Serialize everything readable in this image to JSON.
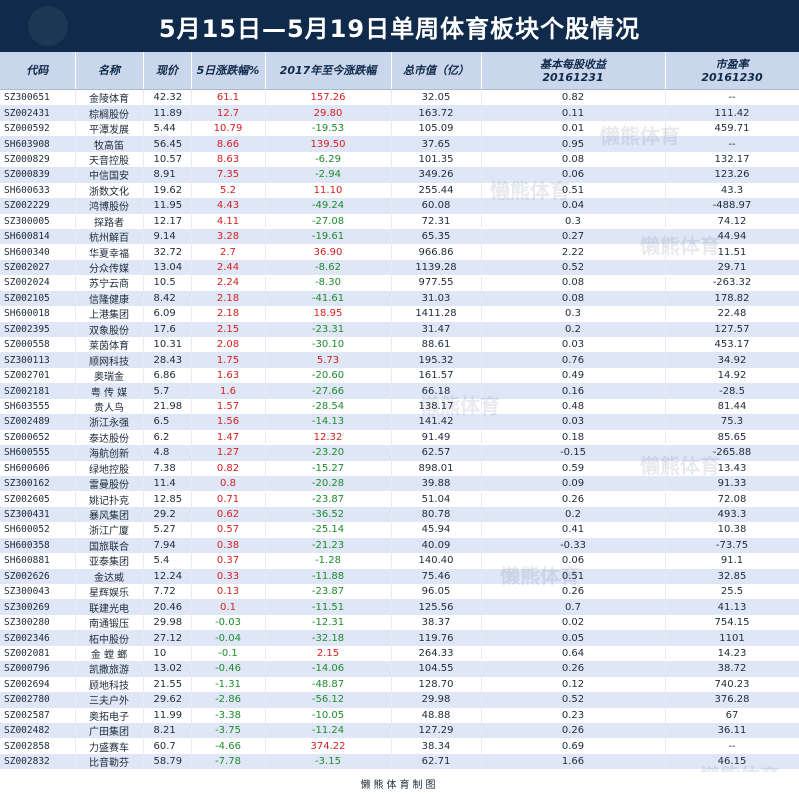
{
  "title": "5月15日—5月19日单周体育板块个股情况",
  "headers": {
    "code": "代码",
    "name": "名称",
    "price": "现价",
    "week_change": "5日涨跌幅%",
    "ytd_change": "2017年至今涨跌幅",
    "market_cap": "总市值（亿）",
    "eps_line1": "基本每股收益",
    "eps_line2": "20161231",
    "pe_line1": "市盈率",
    "pe_line2": "20161230"
  },
  "rows": [
    {
      "code": "SZ300651",
      "name": "金陵体育",
      "price": "42.32",
      "week": "61.1",
      "week_dir": "up",
      "ytd": "157.26",
      "ytd_dir": "up",
      "cap": "32.05",
      "eps": "0.82",
      "pe": "--"
    },
    {
      "code": "SZ002431",
      "name": "棕榈股份",
      "price": "11.89",
      "week": "12.7",
      "week_dir": "up",
      "ytd": "29.80",
      "ytd_dir": "up",
      "cap": "163.72",
      "eps": "0.11",
      "pe": "111.42"
    },
    {
      "code": "SZ000592",
      "name": "平潭发展",
      "price": "5.44",
      "week": "10.79",
      "week_dir": "up",
      "ytd": "-19.53",
      "ytd_dir": "down",
      "cap": "105.09",
      "eps": "0.01",
      "pe": "459.71"
    },
    {
      "code": "SH603908",
      "name": "牧高笛",
      "price": "56.45",
      "week": "8.66",
      "week_dir": "up",
      "ytd": "139.50",
      "ytd_dir": "up",
      "cap": "37.65",
      "eps": "0.95",
      "pe": "--"
    },
    {
      "code": "SZ000829",
      "name": "天音控股",
      "price": "10.57",
      "week": "8.63",
      "week_dir": "up",
      "ytd": "-6.29",
      "ytd_dir": "down",
      "cap": "101.35",
      "eps": "0.08",
      "pe": "132.17"
    },
    {
      "code": "SZ000839",
      "name": "中信国安",
      "price": "8.91",
      "week": "7.35",
      "week_dir": "up",
      "ytd": "-2.94",
      "ytd_dir": "down",
      "cap": "349.26",
      "eps": "0.06",
      "pe": "123.26"
    },
    {
      "code": "SH600633",
      "name": "浙数文化",
      "price": "19.62",
      "week": "5.2",
      "week_dir": "up",
      "ytd": "11.10",
      "ytd_dir": "up",
      "cap": "255.44",
      "eps": "0.51",
      "pe": "43.3"
    },
    {
      "code": "SZ002229",
      "name": "鸿博股份",
      "price": "11.95",
      "week": "4.43",
      "week_dir": "up",
      "ytd": "-49.24",
      "ytd_dir": "down",
      "cap": "60.08",
      "eps": "0.04",
      "pe": "-488.97"
    },
    {
      "code": "SZ300005",
      "name": "探路者",
      "price": "12.17",
      "week": "4.11",
      "week_dir": "up",
      "ytd": "-27.08",
      "ytd_dir": "down",
      "cap": "72.31",
      "eps": "0.3",
      "pe": "74.12"
    },
    {
      "code": "SH600814",
      "name": "杭州解百",
      "price": "9.14",
      "week": "3.28",
      "week_dir": "up",
      "ytd": "-19.61",
      "ytd_dir": "down",
      "cap": "65.35",
      "eps": "0.27",
      "pe": "44.94"
    },
    {
      "code": "SH600340",
      "name": "华夏幸福",
      "price": "32.72",
      "week": "2.7",
      "week_dir": "up",
      "ytd": "36.90",
      "ytd_dir": "up",
      "cap": "966.86",
      "eps": "2.22",
      "pe": "11.51"
    },
    {
      "code": "SZ002027",
      "name": "分众传媒",
      "price": "13.04",
      "week": "2.44",
      "week_dir": "up",
      "ytd": "-8.62",
      "ytd_dir": "down",
      "cap": "1139.28",
      "eps": "0.52",
      "pe": "29.71"
    },
    {
      "code": "SZ002024",
      "name": "苏宁云商",
      "price": "10.5",
      "week": "2.24",
      "week_dir": "up",
      "ytd": "-8.30",
      "ytd_dir": "down",
      "cap": "977.55",
      "eps": "0.08",
      "pe": "-263.32"
    },
    {
      "code": "SZ002105",
      "name": "信隆健康",
      "price": "8.42",
      "week": "2.18",
      "week_dir": "up",
      "ytd": "-41.61",
      "ytd_dir": "down",
      "cap": "31.03",
      "eps": "0.08",
      "pe": "178.82"
    },
    {
      "code": "SH600018",
      "name": "上港集团",
      "price": "6.09",
      "week": "2.18",
      "week_dir": "up",
      "ytd": "18.95",
      "ytd_dir": "up",
      "cap": "1411.28",
      "eps": "0.3",
      "pe": "22.48"
    },
    {
      "code": "SZ002395",
      "name": "双象股份",
      "price": "17.6",
      "week": "2.15",
      "week_dir": "up",
      "ytd": "-23.31",
      "ytd_dir": "down",
      "cap": "31.47",
      "eps": "0.2",
      "pe": "127.57"
    },
    {
      "code": "SZ000558",
      "name": "莱茵体育",
      "price": "10.31",
      "week": "2.08",
      "week_dir": "up",
      "ytd": "-30.10",
      "ytd_dir": "down",
      "cap": "88.61",
      "eps": "0.03",
      "pe": "453.17"
    },
    {
      "code": "SZ300113",
      "name": "顺网科技",
      "price": "28.43",
      "week": "1.75",
      "week_dir": "up",
      "ytd": "5.73",
      "ytd_dir": "up",
      "cap": "195.32",
      "eps": "0.76",
      "pe": "34.92"
    },
    {
      "code": "SZ002701",
      "name": "奥瑞金",
      "price": "6.86",
      "week": "1.63",
      "week_dir": "up",
      "ytd": "-20.60",
      "ytd_dir": "down",
      "cap": "161.57",
      "eps": "0.49",
      "pe": "14.92"
    },
    {
      "code": "SZ002181",
      "name": "粤 传 媒",
      "price": "5.7",
      "week": "1.6",
      "week_dir": "up",
      "ytd": "-27.66",
      "ytd_dir": "down",
      "cap": "66.18",
      "eps": "0.16",
      "pe": "-28.5"
    },
    {
      "code": "SH603555",
      "name": "贵人鸟",
      "price": "21.98",
      "week": "1.57",
      "week_dir": "up",
      "ytd": "-28.54",
      "ytd_dir": "down",
      "cap": "138.17",
      "eps": "0.48",
      "pe": "81.44"
    },
    {
      "code": "SZ002489",
      "name": "浙江永强",
      "price": "6.5",
      "week": "1.56",
      "week_dir": "up",
      "ytd": "-14.13",
      "ytd_dir": "down",
      "cap": "141.42",
      "eps": "0.03",
      "pe": "75.3"
    },
    {
      "code": "SZ000652",
      "name": "泰达股份",
      "price": "6.2",
      "week": "1.47",
      "week_dir": "up",
      "ytd": "12.32",
      "ytd_dir": "up",
      "cap": "91.49",
      "eps": "0.18",
      "pe": "85.65"
    },
    {
      "code": "SH600555",
      "name": "海航创新",
      "price": "4.8",
      "week": "1.27",
      "week_dir": "up",
      "ytd": "-23.20",
      "ytd_dir": "down",
      "cap": "62.57",
      "eps": "-0.15",
      "pe": "-265.88"
    },
    {
      "code": "SH600606",
      "name": "绿地控股",
      "price": "7.38",
      "week": "0.82",
      "week_dir": "up",
      "ytd": "-15.27",
      "ytd_dir": "down",
      "cap": "898.01",
      "eps": "0.59",
      "pe": "13.43"
    },
    {
      "code": "SZ300162",
      "name": "雷曼股份",
      "price": "11.4",
      "week": "0.8",
      "week_dir": "up",
      "ytd": "-20.28",
      "ytd_dir": "down",
      "cap": "39.88",
      "eps": "0.09",
      "pe": "91.33"
    },
    {
      "code": "SZ002605",
      "name": "姚记扑克",
      "price": "12.85",
      "week": "0.71",
      "week_dir": "up",
      "ytd": "-23.87",
      "ytd_dir": "down",
      "cap": "51.04",
      "eps": "0.26",
      "pe": "72.08"
    },
    {
      "code": "SZ300431",
      "name": "暴风集团",
      "price": "29.2",
      "week": "0.62",
      "week_dir": "up",
      "ytd": "-36.52",
      "ytd_dir": "down",
      "cap": "80.78",
      "eps": "0.2",
      "pe": "493.3"
    },
    {
      "code": "SH600052",
      "name": "浙江广厦",
      "price": "5.27",
      "week": "0.57",
      "week_dir": "up",
      "ytd": "-25.14",
      "ytd_dir": "down",
      "cap": "45.94",
      "eps": "0.41",
      "pe": "10.38"
    },
    {
      "code": "SH600358",
      "name": "国旅联合",
      "price": "7.94",
      "week": "0.38",
      "week_dir": "up",
      "ytd": "-21.23",
      "ytd_dir": "down",
      "cap": "40.09",
      "eps": "-0.33",
      "pe": "-73.75"
    },
    {
      "code": "SH600881",
      "name": "亚泰集团",
      "price": "5.4",
      "week": "0.37",
      "week_dir": "up",
      "ytd": "-1.28",
      "ytd_dir": "down",
      "cap": "140.40",
      "eps": "0.06",
      "pe": "91.1"
    },
    {
      "code": "SZ002626",
      "name": "金达威",
      "price": "12.24",
      "week": "0.33",
      "week_dir": "up",
      "ytd": "-11.88",
      "ytd_dir": "down",
      "cap": "75.46",
      "eps": "0.51",
      "pe": "32.85"
    },
    {
      "code": "SZ300043",
      "name": "星辉娱乐",
      "price": "7.72",
      "week": "0.13",
      "week_dir": "up",
      "ytd": "-23.87",
      "ytd_dir": "down",
      "cap": "96.05",
      "eps": "0.26",
      "pe": "25.5"
    },
    {
      "code": "SZ300269",
      "name": "联建光电",
      "price": "20.46",
      "week": "0.1",
      "week_dir": "up",
      "ytd": "-11.51",
      "ytd_dir": "down",
      "cap": "125.56",
      "eps": "0.7",
      "pe": "41.13"
    },
    {
      "code": "SZ300280",
      "name": "南通锻压",
      "price": "29.98",
      "week": "-0.03",
      "week_dir": "down",
      "ytd": "-12.31",
      "ytd_dir": "down",
      "cap": "38.37",
      "eps": "0.02",
      "pe": "754.15"
    },
    {
      "code": "SZ002346",
      "name": "柘中股份",
      "price": "27.12",
      "week": "-0.04",
      "week_dir": "down",
      "ytd": "-32.18",
      "ytd_dir": "down",
      "cap": "119.76",
      "eps": "0.05",
      "pe": "1101"
    },
    {
      "code": "SZ002081",
      "name": "金 螳 螂",
      "price": "10",
      "week": "-0.1",
      "week_dir": "down",
      "ytd": "2.15",
      "ytd_dir": "up",
      "cap": "264.33",
      "eps": "0.64",
      "pe": "14.23"
    },
    {
      "code": "SZ000796",
      "name": "凯撒旅游",
      "price": "13.02",
      "week": "-0.46",
      "week_dir": "down",
      "ytd": "-14.06",
      "ytd_dir": "down",
      "cap": "104.55",
      "eps": "0.26",
      "pe": "38.72"
    },
    {
      "code": "SZ002694",
      "name": "顾地科技",
      "price": "21.55",
      "week": "-1.31",
      "week_dir": "down",
      "ytd": "-48.87",
      "ytd_dir": "down",
      "cap": "128.70",
      "eps": "0.12",
      "pe": "740.23"
    },
    {
      "code": "SZ002780",
      "name": "三夫户外",
      "price": "29.62",
      "week": "-2.86",
      "week_dir": "down",
      "ytd": "-56.12",
      "ytd_dir": "down",
      "cap": "29.98",
      "eps": "0.52",
      "pe": "376.28"
    },
    {
      "code": "SZ002587",
      "name": "奥拓电子",
      "price": "11.99",
      "week": "-3.38",
      "week_dir": "down",
      "ytd": "-10.05",
      "ytd_dir": "down",
      "cap": "48.88",
      "eps": "0.23",
      "pe": "67"
    },
    {
      "code": "SZ002482",
      "name": "广田集团",
      "price": "8.21",
      "week": "-3.75",
      "week_dir": "down",
      "ytd": "-11.24",
      "ytd_dir": "down",
      "cap": "127.29",
      "eps": "0.26",
      "pe": "36.11"
    },
    {
      "code": "SZ002858",
      "name": "力盛赛车",
      "price": "60.7",
      "week": "-4.66",
      "week_dir": "down",
      "ytd": "374.22",
      "ytd_dir": "up",
      "cap": "38.34",
      "eps": "0.69",
      "pe": "--"
    },
    {
      "code": "SZ002832",
      "name": "比音勒芬",
      "price": "58.79",
      "week": "-7.78",
      "week_dir": "down",
      "ytd": "-3.15",
      "ytd_dir": "down",
      "cap": "62.71",
      "eps": "1.66",
      "pe": "46.15"
    }
  ],
  "footer": "懒熊体育制图",
  "watermark": "懒熊体育",
  "colors": {
    "title_bg": "#0f2a4a",
    "header_bg": "#c9d6ec",
    "row_alt": "#dfe7f7",
    "up": "#d42020",
    "down": "#1f8a2e"
  }
}
